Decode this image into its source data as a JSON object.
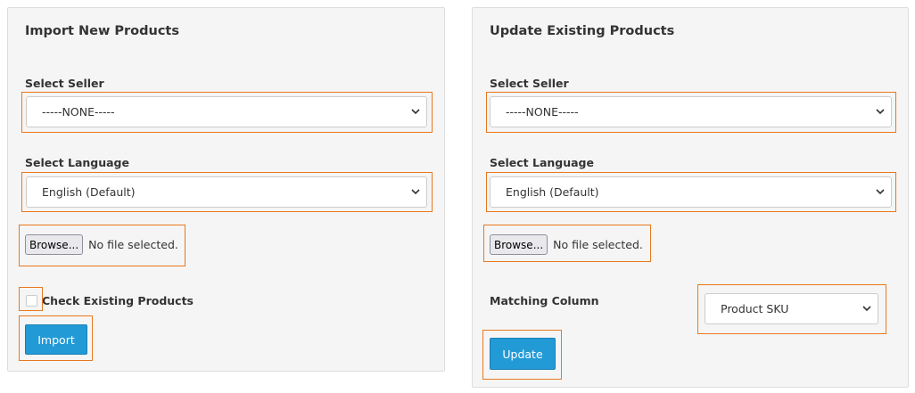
{
  "import_panel": {
    "title": "Import New Products",
    "seller_label": "Select Seller",
    "seller_value": "-----NONE-----",
    "language_label": "Select Language",
    "language_value": "English (Default)",
    "browse_label": "Browse...",
    "file_status": "No file selected.",
    "check_existing_label": "Check Existing Products",
    "check_existing_checked": false,
    "import_button": "Import"
  },
  "update_panel": {
    "title": "Update Existing Products",
    "seller_label": "Select Seller",
    "seller_value": "-----NONE-----",
    "language_label": "Select Language",
    "language_value": "English (Default)",
    "browse_label": "Browse...",
    "file_status": "No file selected.",
    "matching_column_label": "Matching Column",
    "matching_column_value": "Product SKU",
    "update_button": "Update"
  },
  "colors": {
    "panel_bg": "#f5f5f5",
    "highlight": "#e8781f",
    "button": "#229ad6"
  }
}
